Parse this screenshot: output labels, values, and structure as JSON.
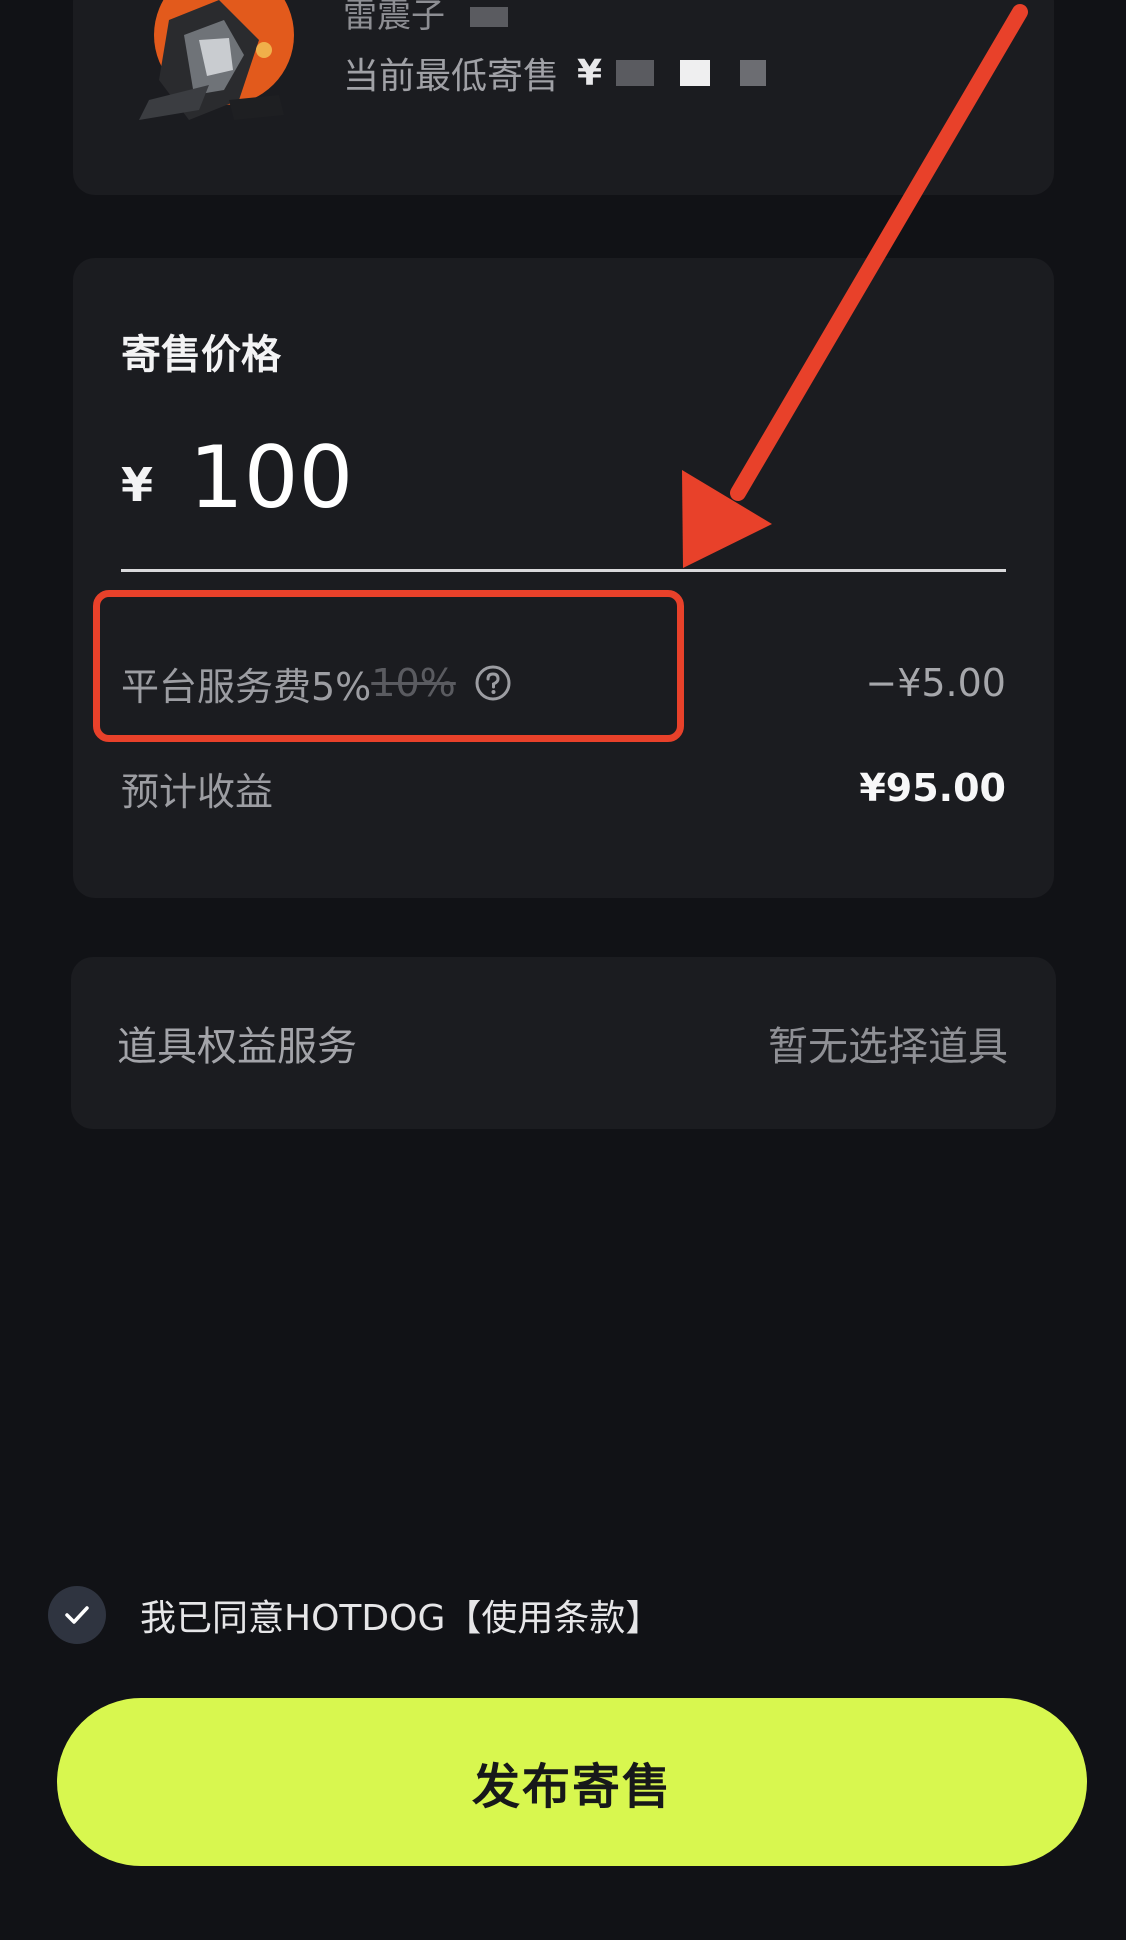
{
  "item": {
    "name": "雷震子",
    "lowest_label": "当前最低寄售",
    "lowest_currency": "¥"
  },
  "price": {
    "title": "寄售价格",
    "currency": "¥",
    "value": "100"
  },
  "fee": {
    "label": "平台服务费5%",
    "old_rate": "10%",
    "amount": "−¥5.00"
  },
  "earnings": {
    "label": "预计收益",
    "amount": "¥95.00"
  },
  "props": {
    "label": "道具权益服务",
    "value": "暂无选择道具"
  },
  "agreement": {
    "checked": true,
    "text": "我已同意HOTDOG【使用条款】"
  },
  "publish": {
    "label": "发布寄售"
  },
  "colors": {
    "accent": "#d8f74f",
    "annotation": "#e8412a",
    "background": "#111216",
    "card": "#1b1c20"
  }
}
